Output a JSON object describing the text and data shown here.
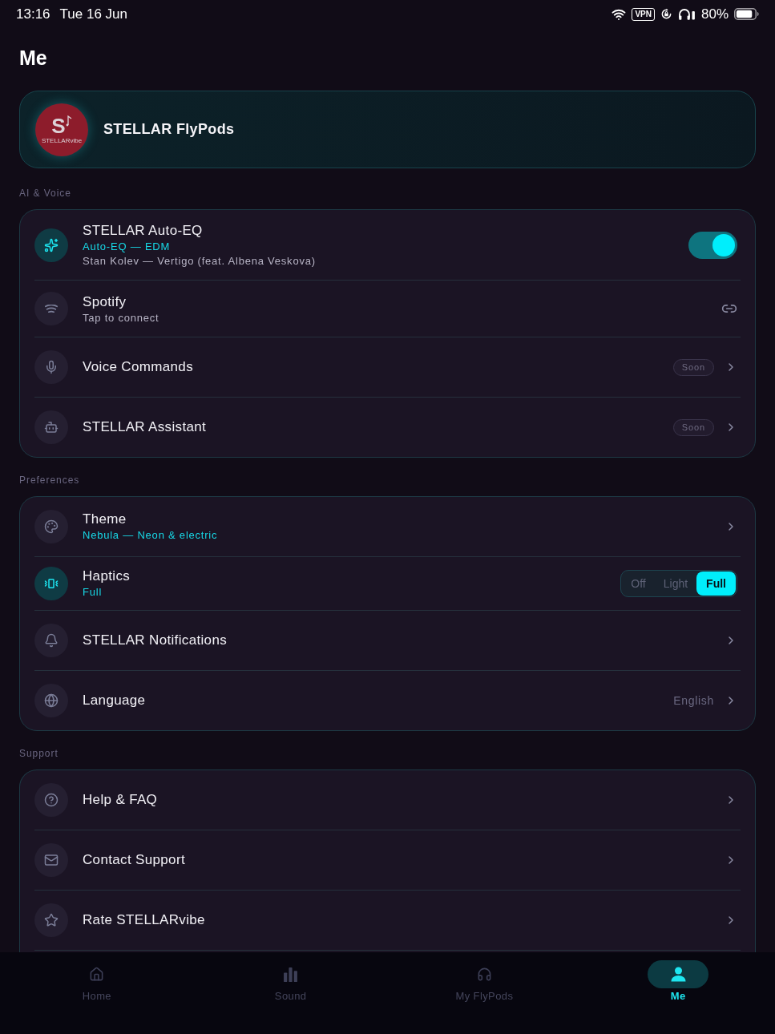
{
  "status_bar": {
    "time": "13:16",
    "date": "Tue 16 Jun",
    "vpn": "VPN",
    "battery": "80%"
  },
  "title": "Me",
  "device": {
    "logo_letter": "S",
    "logo_caption": "STELLARvibe",
    "name": "STELLAR FlyPods"
  },
  "sections": [
    {
      "label": "AI & Voice",
      "rows": [
        {
          "kind": "toggle",
          "title": "STELLAR Auto-EQ",
          "subtitle": "Auto-EQ — EDM",
          "detail": "Stan Kolev — Vertigo (feat. Albena Veskova)",
          "active": true,
          "on": true
        },
        {
          "kind": "link",
          "title": "Spotify",
          "detail": "Tap to connect",
          "active": false
        },
        {
          "kind": "nav",
          "title": "Voice Commands",
          "badge": "Soon",
          "active": false
        },
        {
          "kind": "nav",
          "title": "STELLAR Assistant",
          "badge": "Soon",
          "active": false
        }
      ]
    },
    {
      "label": "Preferences",
      "rows": [
        {
          "kind": "nav",
          "title": "Theme",
          "subtitle": "Nebula — Neon & electric",
          "active": false
        },
        {
          "kind": "segmented",
          "title": "Haptics",
          "subtitle": "Full",
          "active": true,
          "options": [
            {
              "label": "Off",
              "selected": false
            },
            {
              "label": "Light",
              "selected": false
            },
            {
              "label": "Full",
              "selected": true
            }
          ]
        },
        {
          "kind": "nav",
          "title": "STELLAR Notifications",
          "active": false
        },
        {
          "kind": "nav",
          "title": "Language",
          "value": "English",
          "active": false
        }
      ]
    },
    {
      "label": "Support",
      "rows": [
        {
          "kind": "nav",
          "title": "Help & FAQ",
          "active": false
        },
        {
          "kind": "nav",
          "title": "Contact Support",
          "active": false
        },
        {
          "kind": "nav",
          "title": "Rate STELLARvibe",
          "active": false
        }
      ]
    }
  ],
  "nav": [
    {
      "label": "Home",
      "selected": false
    },
    {
      "label": "Sound",
      "selected": false
    },
    {
      "label": "My FlyPods",
      "selected": false
    },
    {
      "label": "Me",
      "selected": true
    }
  ]
}
